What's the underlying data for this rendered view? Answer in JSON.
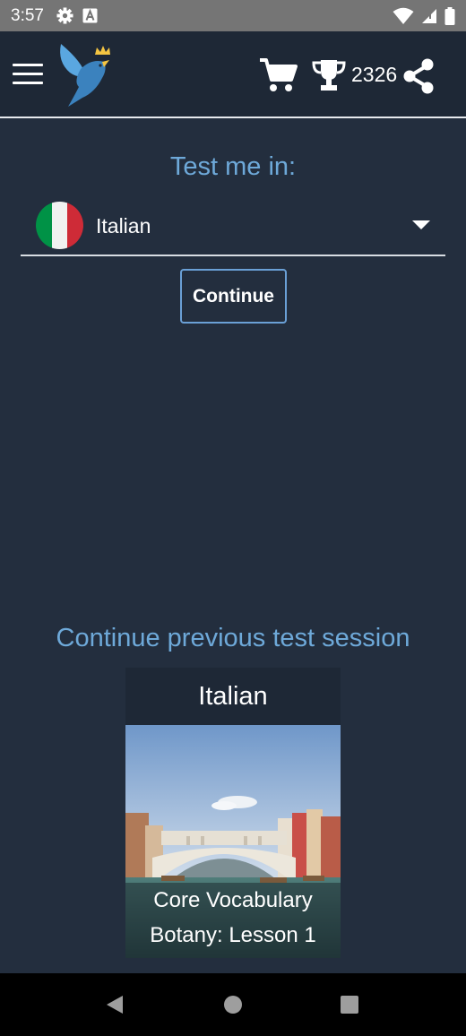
{
  "status_bar": {
    "time": "3:57",
    "icons": [
      "gear-icon",
      "a-badge-icon",
      "wifi-icon",
      "signal-icon",
      "battery-icon"
    ]
  },
  "app_bar": {
    "icons": [
      "menu-icon",
      "bird-logo",
      "cart-icon",
      "trophy-icon",
      "share-icon"
    ],
    "score": "2326"
  },
  "test_section": {
    "title": "Test me in:",
    "selected_language": "Italian",
    "flag_colors": [
      "#009246",
      "#f1f2f1",
      "#ce2b37"
    ],
    "continue_label": "Continue"
  },
  "previous_session": {
    "title": "Continue previous test session",
    "card": {
      "language": "Italian",
      "line1": "Core Vocabulary",
      "line2": "Botany: Lesson 1"
    }
  },
  "colors": {
    "background": "#232e3e",
    "app_bar": "#1e2836",
    "accent": "#6ea9d9"
  }
}
